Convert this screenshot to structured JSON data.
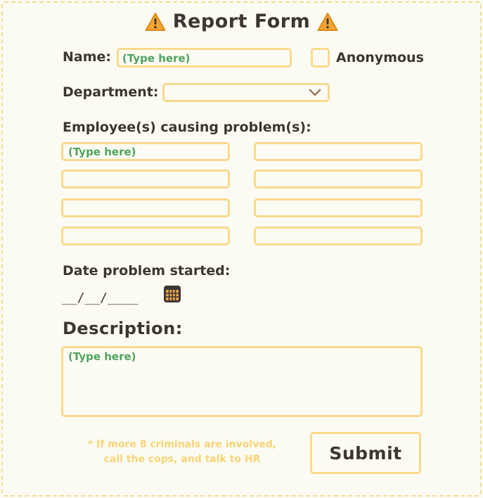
{
  "form": {
    "title": "Report Form",
    "title_icon": "warning-icon",
    "name_label": "Name:",
    "name_placeholder": "(Type here)",
    "anonymous_label": "Anonymous",
    "anonymous_checked": false,
    "department_label": "Department:",
    "department_value": "",
    "employees_label": "Employee(s) causing problem(s):",
    "employee_fields": [
      "(Type here)",
      "",
      "",
      "",
      "",
      "",
      "",
      ""
    ],
    "date_label": "Date problem started:",
    "date_value": "__/__/____",
    "calendar_icon": "calendar-icon",
    "description_label": "Description:",
    "description_placeholder": "(Type here)",
    "note_line1": "* If more 8 criminals are involved,",
    "note_line2": "call the cops, and talk to HR",
    "submit_label": "Submit"
  },
  "colors": {
    "background": "#fcfbf3",
    "border": "#f9d98d",
    "placeholder": "#4fa35f",
    "text": "#3d3532",
    "note": "#f7d477",
    "warning": "#f4a534"
  }
}
